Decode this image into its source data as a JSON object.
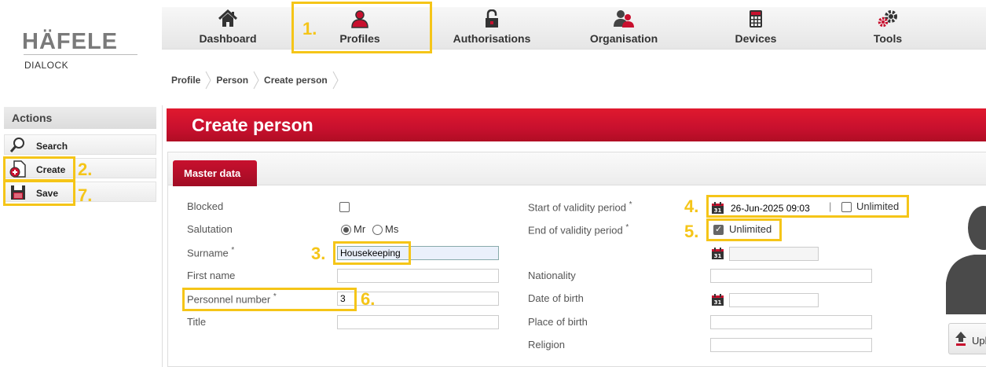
{
  "brand": {
    "logo_text": "HÄFELE",
    "sub_text": "DIALOCK"
  },
  "topnav": [
    {
      "label": "Dashboard",
      "icon": "home-icon"
    },
    {
      "label": "Profiles",
      "icon": "user-icon"
    },
    {
      "label": "Authorisations",
      "icon": "lock-icon"
    },
    {
      "label": "Organisation",
      "icon": "people-icon"
    },
    {
      "label": "Devices",
      "icon": "keypad-icon"
    },
    {
      "label": "Tools",
      "icon": "gears-icon"
    }
  ],
  "breadcrumb": [
    "Profile",
    "Person",
    "Create person"
  ],
  "sidebar": {
    "heading": "Actions",
    "buttons": [
      {
        "label": "Search",
        "icon": "magnifier-icon"
      },
      {
        "label": "Create",
        "icon": "new-document-icon"
      },
      {
        "label": "Save",
        "icon": "floppy-disk-icon"
      }
    ]
  },
  "page": {
    "title": "Create person",
    "tab": "Master data"
  },
  "form": {
    "blocked_label": "Blocked",
    "blocked_checked": false,
    "salutation_label": "Salutation",
    "salutation_options": [
      "Mr",
      "Ms"
    ],
    "salutation_selected": "Mr",
    "surname_label": "Surname",
    "surname_value": "Housekeeping",
    "firstname_label": "First name",
    "firstname_value": "",
    "personnel_label": "Personnel number",
    "personnel_value": "3",
    "title_label": "Title",
    "title_value": "",
    "required_mark": "*",
    "start_label": "Start of validity period",
    "start_value": "26-Jun-2025 09:03",
    "start_divider": "|",
    "start_unlimited_label": "Unlimited",
    "start_unlimited_checked": false,
    "end_label": "End of validity period",
    "end_unlimited_label": "Unlimited",
    "end_unlimited_checked": true,
    "end_value": "",
    "nationality_label": "Nationality",
    "nationality_value": "",
    "dob_label": "Date of birth",
    "dob_value": "",
    "pob_label": "Place of birth",
    "pob_value": "",
    "religion_label": "Religion",
    "religion_value": "",
    "calendar_day": "31"
  },
  "upload_label": "Upl",
  "annotations": [
    "1.",
    "2.",
    "3.",
    "4.",
    "5.",
    "6.",
    "7."
  ],
  "colors": {
    "accent_red": "#c8102e",
    "highlight_yellow": "#f5c518",
    "nav_bg": "#eeeeee"
  }
}
